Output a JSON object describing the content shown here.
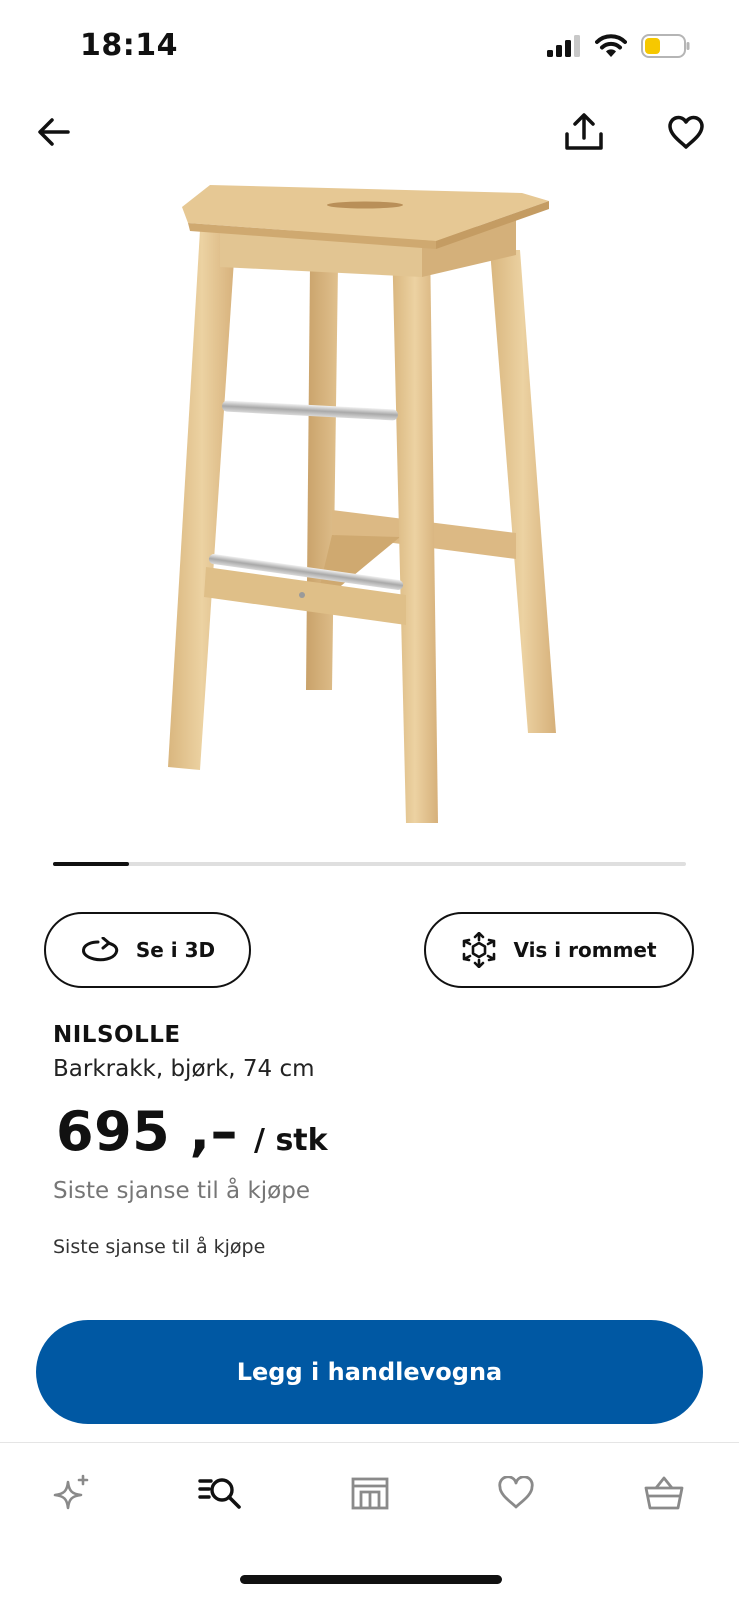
{
  "status_bar": {
    "time": "18:14",
    "icons": [
      "cellular-signal-icon",
      "wifi-icon",
      "battery-low-icon"
    ],
    "battery_color": "#f6c800"
  },
  "top_nav": {
    "icons": [
      "back-arrow-icon",
      "share-icon",
      "heart-icon"
    ]
  },
  "carousel": {
    "current_image": 1,
    "progress_fraction": 0.12
  },
  "actions": {
    "view_3d": {
      "label": "Se i 3D",
      "icon": "rotate-3d-icon"
    },
    "view_in_room": {
      "label": "Vis i rommet",
      "icon": "augmented-reality-icon"
    }
  },
  "product": {
    "name": "NILSOLLE",
    "description": "Barkrakk, bjørk, 74 cm",
    "price": "695 ,–",
    "price_unit": "/ stk",
    "availability_note": "Siste sjanse til å kjøpe",
    "availability_note_secondary": "Siste sjanse til å kjøpe"
  },
  "cart_button": {
    "label": "Legg i handlevogna",
    "color": "#0058a3"
  },
  "tab_bar": {
    "active_tab": "search",
    "tabs": [
      {
        "id": "inspiration",
        "icon": "sparkle-icon"
      },
      {
        "id": "search",
        "icon": "search-list-icon"
      },
      {
        "id": "store",
        "icon": "store-icon"
      },
      {
        "id": "favourites",
        "icon": "heart-icon"
      },
      {
        "id": "cart",
        "icon": "shopping-basket-icon"
      }
    ]
  },
  "colors": {
    "accent": "#0058a3",
    "text": "#111111",
    "muted_text": "#767676",
    "inactive_icon": "#8a8a8a"
  }
}
